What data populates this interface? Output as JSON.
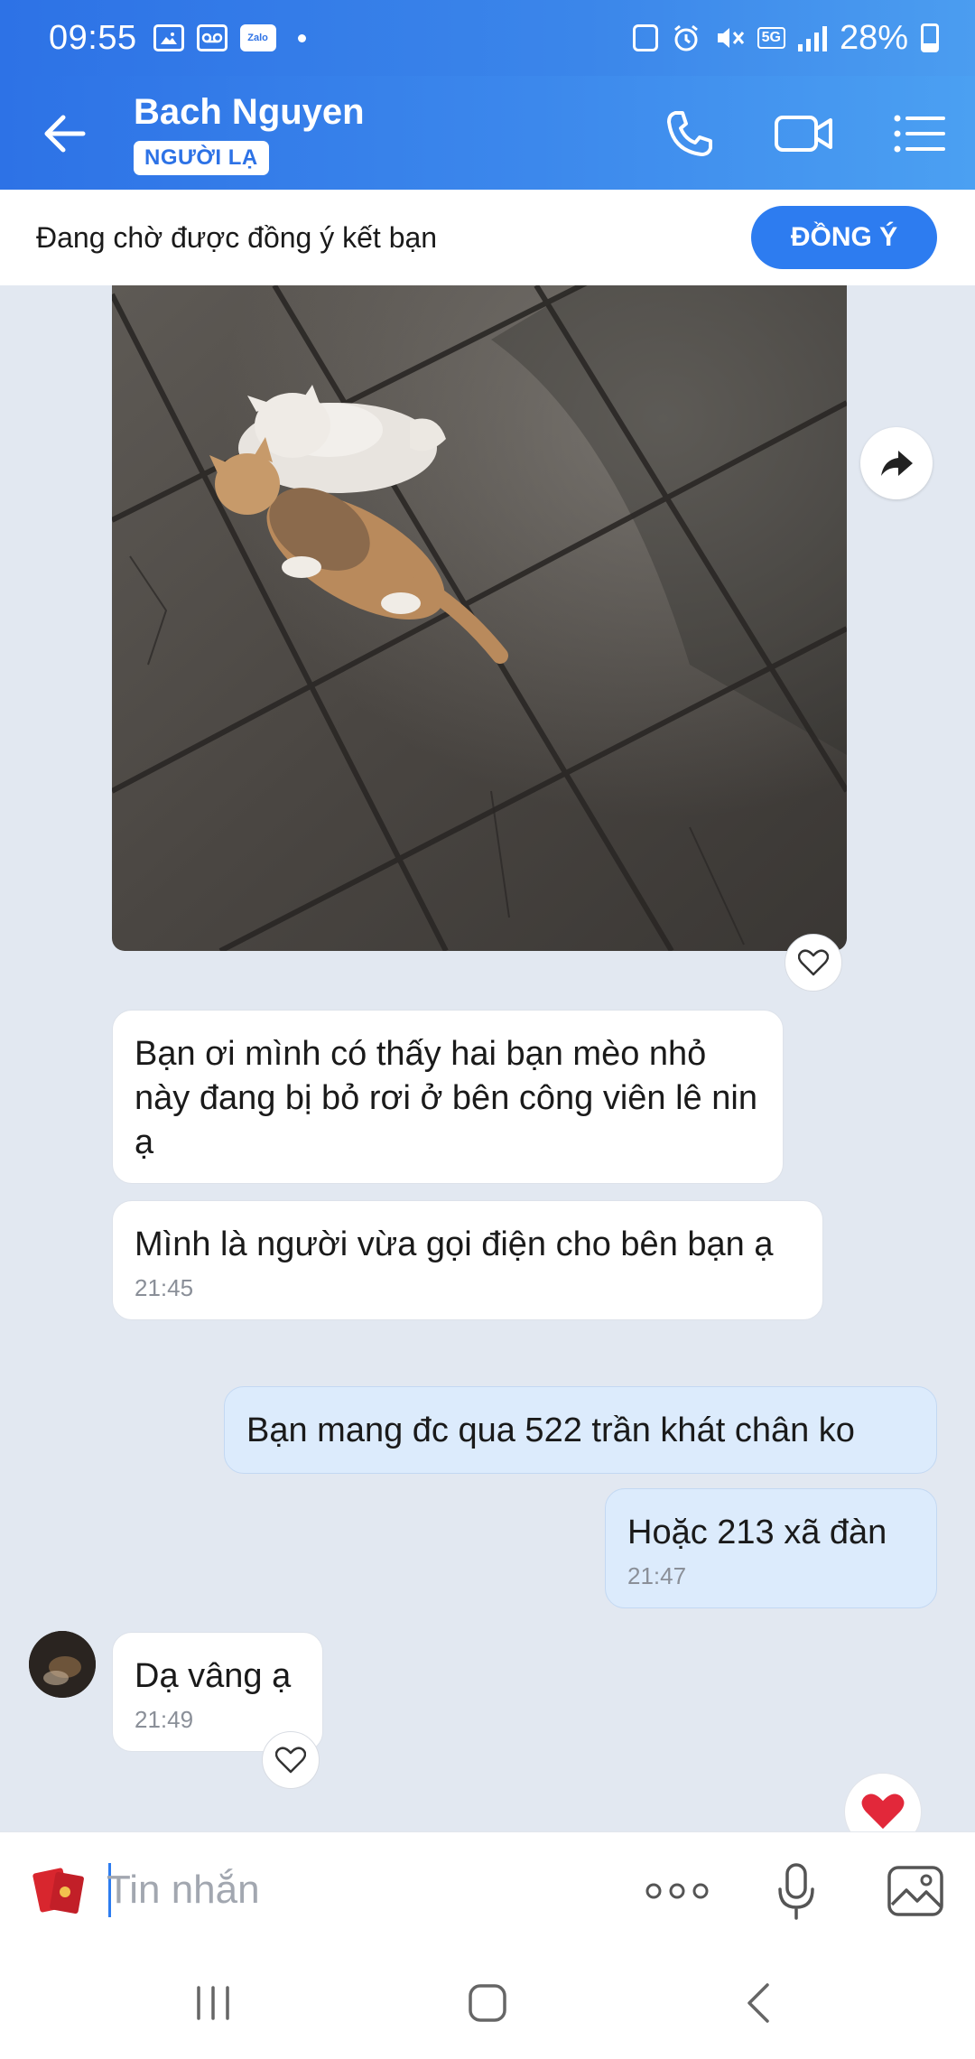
{
  "status_bar": {
    "time": "09:55",
    "zalo_label": "Zalo",
    "network": "5G",
    "battery": "28%"
  },
  "header": {
    "contact_name": "Bach Nguyen",
    "badge": "NGƯỜI LẠ"
  },
  "friend_request": {
    "text": "Đang chờ được đồng ý kết bạn",
    "button": "ĐỒNG Ý"
  },
  "messages": [
    {
      "from": "contact",
      "text": "Bạn ơi mình có thấy hai bạn mèo nhỏ này đang bị bỏ rơi ở bên công viên lê nin ạ"
    },
    {
      "from": "contact",
      "text": "Mình là người vừa gọi điện cho bên bạn ạ",
      "time": "21:45"
    },
    {
      "from": "me",
      "text": "Bạn mang đc qua 522 trần khát chân ko"
    },
    {
      "from": "me",
      "text": "Hoặc 213 xã đàn",
      "time": "21:47"
    },
    {
      "from": "contact",
      "text": "Dạ vâng ạ",
      "time": "21:49"
    }
  ],
  "composer": {
    "placeholder": "Tin nhắn"
  },
  "colors": {
    "header_blue": "#2d72e6",
    "accent": "#2d7cf0",
    "chat_bg": "#e2e8f1",
    "my_bubble": "#dcebfc"
  }
}
